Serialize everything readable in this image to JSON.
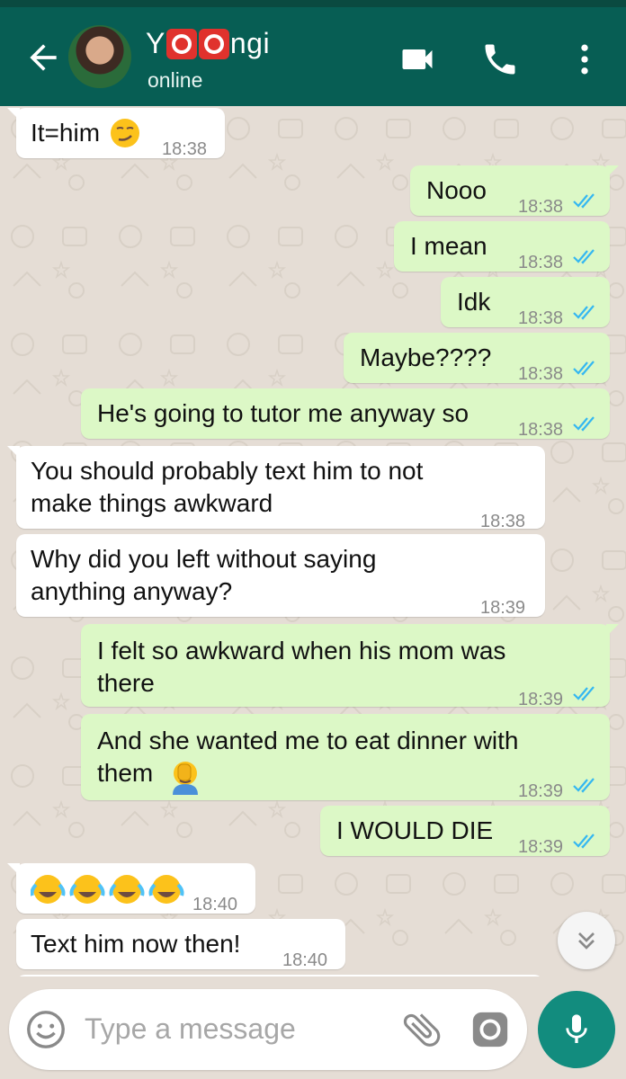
{
  "header": {
    "name_prefix": "Y",
    "name_suffix": "ngi",
    "status": "online",
    "icons": [
      "back-arrow-icon",
      "video-call-icon",
      "phone-icon",
      "more-vert-icon"
    ]
  },
  "messages": [
    {
      "dir": "in",
      "lines": [
        "It=him"
      ],
      "emoji": "smirk",
      "time": "18:38"
    },
    {
      "dir": "out",
      "lines": [
        "Nooo"
      ],
      "time": "18:38",
      "read": true
    },
    {
      "dir": "out",
      "lines": [
        "I mean"
      ],
      "time": "18:38",
      "read": true
    },
    {
      "dir": "out",
      "lines": [
        "Idk"
      ],
      "time": "18:38",
      "read": true
    },
    {
      "dir": "out",
      "lines": [
        "Maybe????"
      ],
      "time": "18:38",
      "read": true
    },
    {
      "dir": "out",
      "lines": [
        "He's going to tutor me anyway so"
      ],
      "time": "18:38",
      "read": true
    },
    {
      "dir": "in",
      "lines": [
        "You should probably text him to not",
        "make things awkward"
      ],
      "time": "18:38"
    },
    {
      "dir": "in",
      "lines": [
        "Why did you left without saying",
        "anything anyway?"
      ],
      "time": "18:39"
    },
    {
      "dir": "out",
      "lines": [
        "I felt so awkward when his mom was",
        "there"
      ],
      "time": "18:39",
      "read": true
    },
    {
      "dir": "out",
      "lines": [
        "And she wanted me to eat dinner with",
        "them"
      ],
      "emoji": "facepalm",
      "time": "18:39",
      "read": true
    },
    {
      "dir": "out",
      "lines": [
        "I WOULD DIE"
      ],
      "time": "18:39",
      "read": true
    },
    {
      "dir": "in",
      "lines": [
        ""
      ],
      "emoji": "tears-of-joy-x4",
      "time": "18:40"
    },
    {
      "dir": "in",
      "lines": [
        "Text him now then!"
      ],
      "time": "18:40"
    }
  ],
  "composer": {
    "placeholder": "Type a message"
  },
  "colors": {
    "appbar": "#075e54",
    "outgoing": "#dcf8c6",
    "incoming": "#ffffff",
    "read_ticks": "#34b7f1",
    "fab": "#128c7e"
  }
}
